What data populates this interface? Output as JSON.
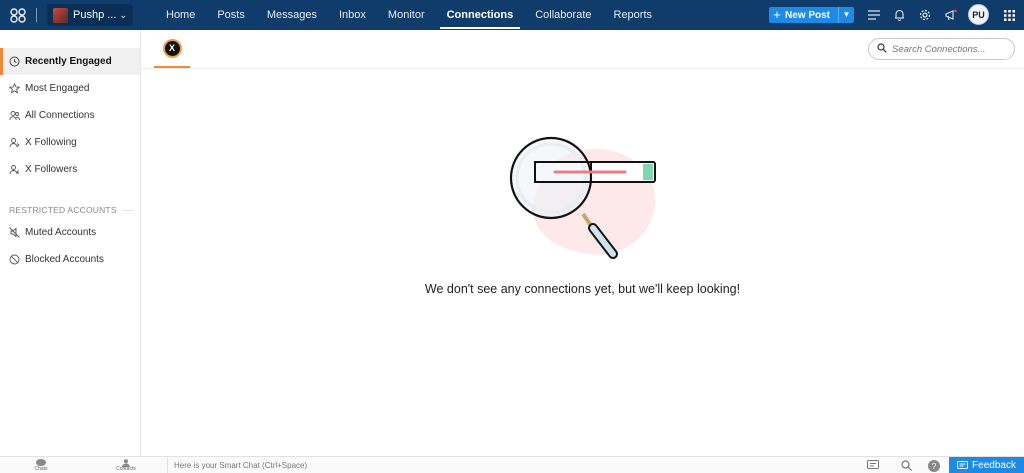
{
  "topbar": {
    "account_name": "Pushp ...",
    "nav": [
      "Home",
      "Posts",
      "Messages",
      "Inbox",
      "Monitor",
      "Connections",
      "Collaborate",
      "Reports"
    ],
    "active_nav": "Connections",
    "new_post_label": "New Post",
    "user_initials": "PU"
  },
  "sidebar": {
    "items": [
      {
        "label": "Recently Engaged",
        "icon": "clock-icon",
        "active": true
      },
      {
        "label": "Most Engaged",
        "icon": "star-icon",
        "active": false
      },
      {
        "label": "All Connections",
        "icon": "users-icon",
        "active": false
      },
      {
        "label": "X Following",
        "icon": "user-following-icon",
        "active": false
      },
      {
        "label": "X Followers",
        "icon": "user-followers-icon",
        "active": false
      }
    ],
    "section_label": "RESTRICTED ACCOUNTS",
    "restricted_items": [
      {
        "label": "Muted Accounts",
        "icon": "muted-icon"
      },
      {
        "label": "Blocked Accounts",
        "icon": "blocked-icon"
      }
    ]
  },
  "main": {
    "network_tab_glyph": "X",
    "search_placeholder": "Search Connections...",
    "empty_message": "We don't see any connections yet, but we'll keep looking!"
  },
  "bottombar": {
    "chats_label": "Chats",
    "contacts_label": "Contacts",
    "smart_chat_placeholder": "Here is your Smart Chat (Ctrl+Space)",
    "feedback_label": "Feedback"
  },
  "colors": {
    "topbar_bg": "#0f3c6b",
    "accent_orange": "#f0883a",
    "primary_blue": "#1d8ae6"
  }
}
